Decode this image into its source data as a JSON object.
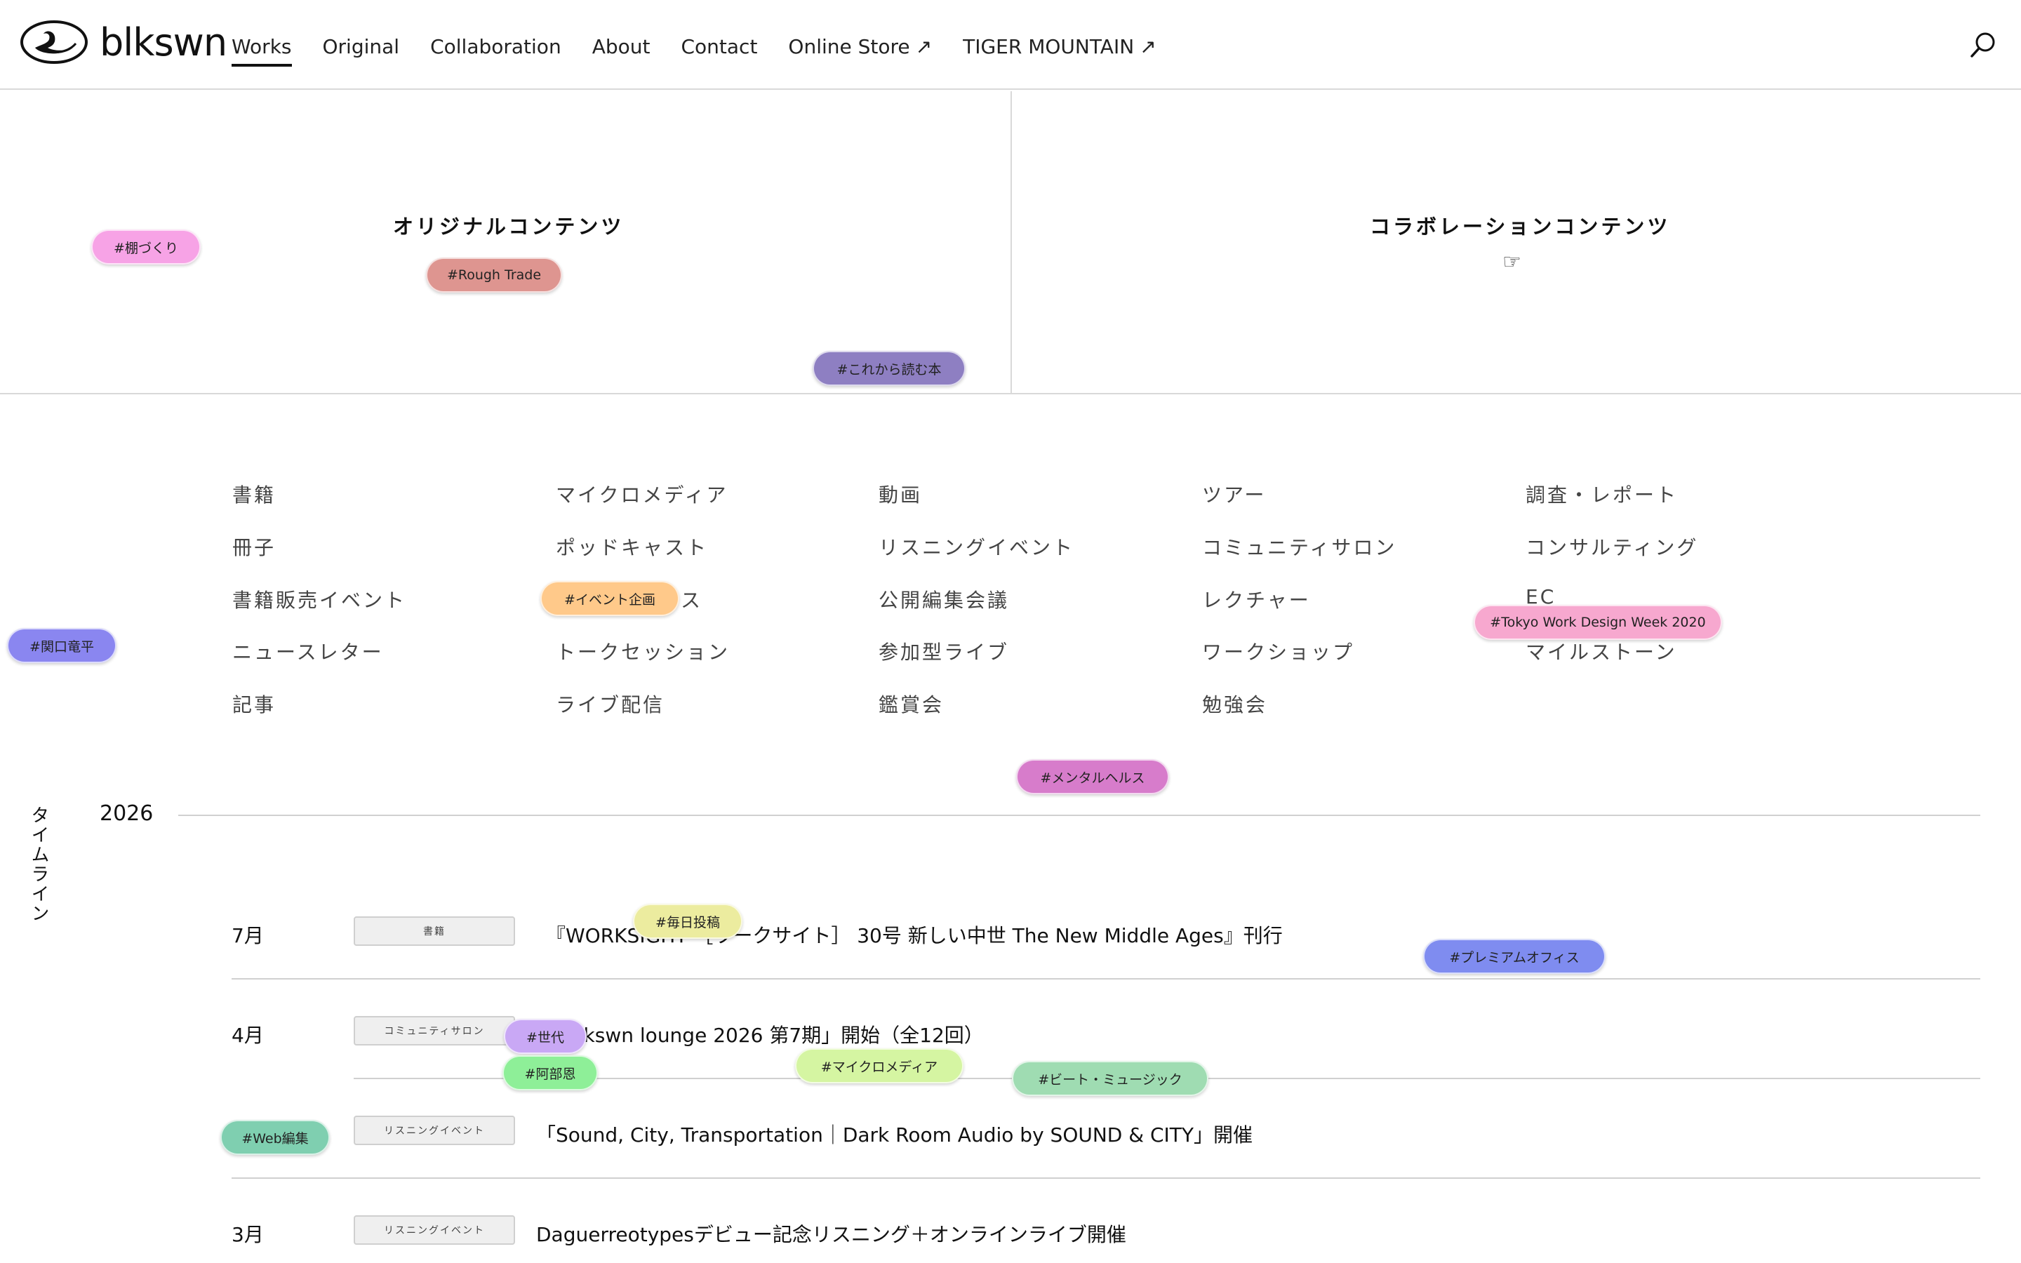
{
  "header": {
    "logo_text": "blkswn",
    "nav": [
      {
        "label": "Works",
        "active": true,
        "external": false
      },
      {
        "label": "Original",
        "active": false,
        "external": false
      },
      {
        "label": "Collaboration",
        "active": false,
        "external": false
      },
      {
        "label": "About",
        "active": false,
        "external": false
      },
      {
        "label": "Contact",
        "active": false,
        "external": false
      },
      {
        "label": "Online Store",
        "active": false,
        "external": true
      },
      {
        "label": "TIGER MOUNTAIN",
        "active": false,
        "external": true
      }
    ],
    "external_arrow": "↗",
    "search_icon": "search-icon"
  },
  "hero": {
    "left_title": "オリジナルコンテンツ",
    "right_title": "コラボレーションコンテンツ",
    "pointer": "☞"
  },
  "tags": [
    {
      "label": "#棚づくり",
      "color": "#f7a3e6"
    },
    {
      "label": "#Rough Trade",
      "color": "#de9590"
    },
    {
      "label": "#これから読む本",
      "color": "#8e7fc2"
    },
    {
      "label": "#イベント企画",
      "color": "#ffc98a"
    },
    {
      "label": "#関口竜平",
      "color": "#8a86f0"
    },
    {
      "label": "#Tokyo Work Design Week 2020",
      "color": "#f7a8cf"
    },
    {
      "label": "#メンタルヘルス",
      "color": "#d77ccb"
    },
    {
      "label": "#毎日投稿",
      "color": "#ecec9f"
    },
    {
      "label": "#プレミアムオフィス",
      "color": "#7f8cf0"
    },
    {
      "label": "#世代",
      "color": "#c9a8f5"
    },
    {
      "label": "#阿部恩",
      "color": "#8eef98"
    },
    {
      "label": "#マイクロメディア",
      "color": "#d5f5a2"
    },
    {
      "label": "#ビート・ミュージック",
      "color": "#9fdcb2"
    },
    {
      "label": "#Web編集",
      "color": "#7fcfb0"
    }
  ],
  "categories": {
    "col1": [
      "書籍",
      "冊子",
      "書籍販売イベント",
      "ニュースレター",
      "記事"
    ],
    "col2": [
      "マイクロメディア",
      "ポッドキャスト",
      "ス",
      "トークセッション",
      "ライブ配信"
    ],
    "col3": [
      "動画",
      "リスニングイベント",
      "公開編集会議",
      "参加型ライブ",
      "鑑賞会"
    ],
    "col4": [
      "ツアー",
      "コミュニティサロン",
      "レクチャー",
      "ワークショップ",
      "勉強会"
    ],
    "col5": [
      "調査・レポート",
      "コンサルティング",
      "EC",
      "マイルストーン"
    ]
  },
  "timeline": {
    "label": "タイムライン",
    "year": "2026",
    "entries": [
      {
        "month": "7月",
        "badge": "書籍",
        "title": "『WORKSIGHT ［ワークサイト］ 30号 新しい中世 The New Middle Ages』刊行"
      },
      {
        "month": "4月",
        "badge": "コミュニティサロン",
        "title": "「blkswn lounge 2026 第7期」開始（全12回）"
      },
      {
        "month": "",
        "badge": "リスニングイベント",
        "title": "「Sound, City, Transportation｜Dark Room Audio by SOUND & CITY」開催"
      },
      {
        "month": "3月",
        "badge": "リスニングイベント",
        "title": "Daguerreotypesデビュー記念リスニング＋オンラインライブ開催"
      }
    ]
  }
}
